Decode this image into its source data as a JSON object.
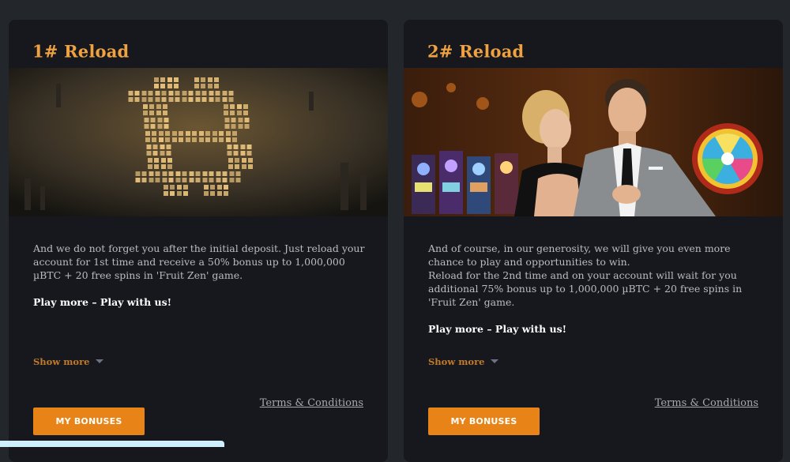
{
  "cards": [
    {
      "title": "1# Reload",
      "image_subject": "bitcoin-circuit-image",
      "paragraphs": [
        "And we do not forget you after the initial deposit. Just reload your account for 1st time and receive a 50% bonus up to 1,000,000 µBTC + 20 free spins in 'Fruit Zen' game."
      ],
      "cta": "Play more – Play with us!",
      "show_more": "Show more",
      "terms": "Terms & Conditions",
      "button": "MY BONUSES"
    },
    {
      "title": "2# Reload",
      "image_subject": "casino-couple-image",
      "paragraphs": [
        "And of course, in our generosity, we will give you even more chance to play and opportunities to win.",
        "Reload for the 2nd time and on your account will wait for you additional 75% bonus up to 1,000,000 µBTC + 20 free spins in 'Fruit Zen' game."
      ],
      "cta": "Play more – Play with us!",
      "show_more": "Show more",
      "terms": "Terms & Conditions",
      "button": "MY BONUSES"
    }
  ],
  "colors": {
    "accent": "#f0a242",
    "button": "#e88417",
    "card_bg": "#17181d",
    "page_bg": "#23262b"
  }
}
